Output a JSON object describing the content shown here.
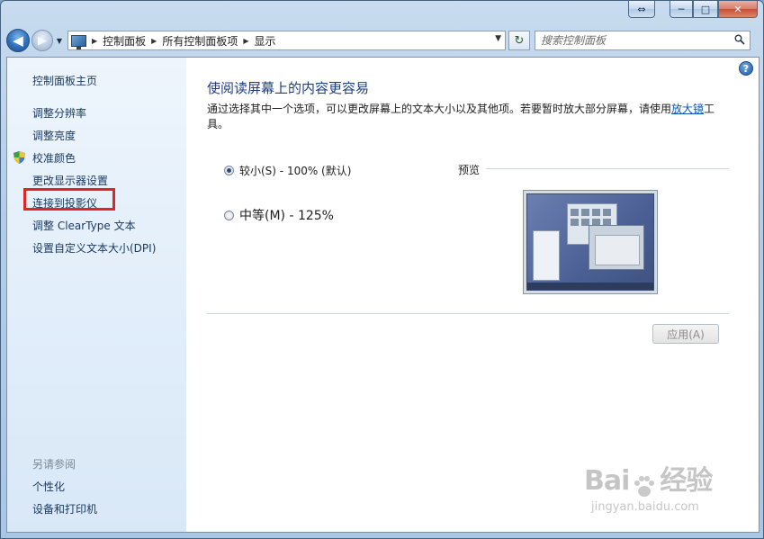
{
  "caption": {
    "min": "─",
    "max": "□",
    "close": "✕",
    "extra": "⇔"
  },
  "nav": {
    "back": "◀",
    "forward": "▶",
    "history": "▼",
    "breadcrumbs": [
      "控制面板",
      "所有控制面板项",
      "显示"
    ],
    "separator": "▶",
    "dropdown": "▼",
    "refresh": "↻"
  },
  "search": {
    "placeholder": "搜索控制面板"
  },
  "sidebar": {
    "home": "控制面板主页",
    "items": [
      "调整分辨率",
      "调整亮度",
      "校准颜色",
      "更改显示器设置",
      "连接到投影仪",
      "调整 ClearType 文本",
      "设置自定义文本大小(DPI)"
    ],
    "see_also_title": "另请参阅",
    "see_also": [
      "个性化",
      "设备和打印机"
    ]
  },
  "main": {
    "help": "?",
    "heading": "使阅读屏幕上的内容更容易",
    "description_before": "通过选择其中一个选项，可以更改屏幕上的文本大小以及其他项。若要暂时放大部分屏幕，请使用",
    "description_link": "放大镜",
    "description_after": "工具。",
    "options": [
      {
        "label": "较小(S) - 100% (默认)",
        "selected": true
      },
      {
        "label": "中等(M) - 125%",
        "selected": false
      }
    ],
    "preview_label": "预览",
    "apply": "应用(A)"
  },
  "watermark": {
    "logo_left": "Bai",
    "logo_right": "经验",
    "url": "jingyan.baidu.com"
  },
  "colors": {
    "heading": "#1c3f8c",
    "link": "#0a55b8",
    "highlight": "#e02525",
    "sidebar": "#e2eefa"
  }
}
